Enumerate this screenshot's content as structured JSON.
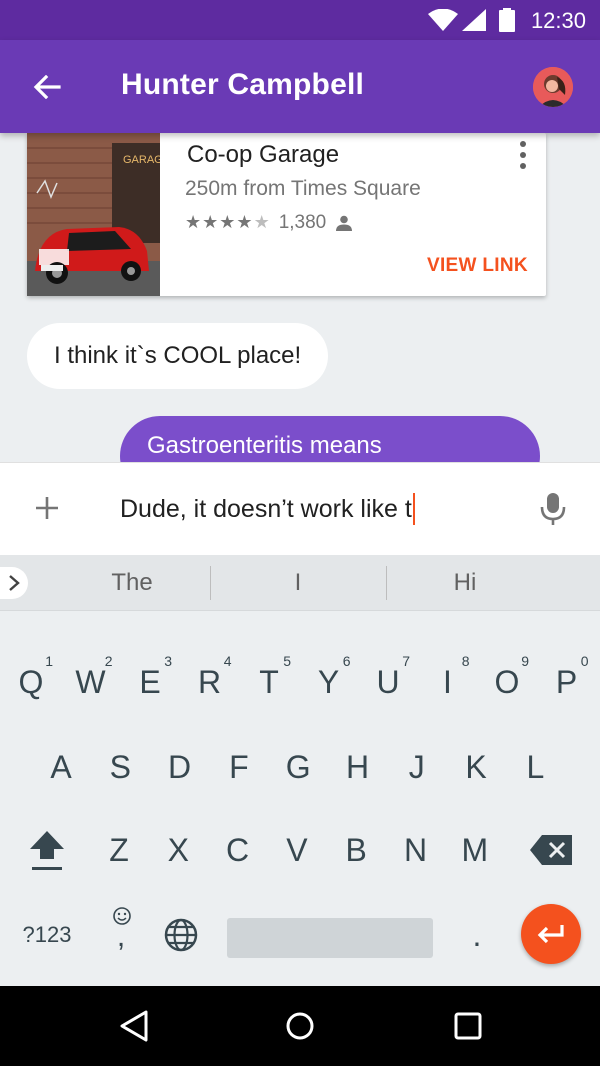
{
  "status_bar": {
    "time": "12:30"
  },
  "app_bar": {
    "contact_name": "Hunter Campbell"
  },
  "place_card": {
    "title": "Co-op Garage",
    "distance": "250m from Times Square",
    "rating": 4,
    "rating_max": 5,
    "rating_count": "1,380",
    "sign_text": "GARAGE",
    "action_label": "VIEW LINK"
  },
  "messages": {
    "incoming": "I think it`s COOL place!",
    "outgoing": "Gastroenteritis means"
  },
  "composer": {
    "input_value": "Dude, it doesn’t work like t"
  },
  "keyboard": {
    "suggestions": [
      "The",
      "I",
      "Hi"
    ],
    "row1": [
      {
        "label": "Q",
        "hint": "1"
      },
      {
        "label": "W",
        "hint": "2"
      },
      {
        "label": "E",
        "hint": "3"
      },
      {
        "label": "R",
        "hint": "4"
      },
      {
        "label": "T",
        "hint": "5"
      },
      {
        "label": "Y",
        "hint": "6"
      },
      {
        "label": "U",
        "hint": "7"
      },
      {
        "label": "I",
        "hint": "8"
      },
      {
        "label": "O",
        "hint": "9"
      },
      {
        "label": "P",
        "hint": "0"
      }
    ],
    "row2": [
      "A",
      "S",
      "D",
      "F",
      "G",
      "H",
      "J",
      "K",
      "L"
    ],
    "row3": [
      "Z",
      "X",
      "C",
      "V",
      "B",
      "N",
      "M"
    ],
    "symbols_label": "?123",
    "comma_label": ",",
    "period_label": "."
  },
  "colors": {
    "primary": "#6a3ab5",
    "status_bar": "#5e2ba0",
    "outgoing_bubble": "#7b4ecb",
    "accent": "#f4511e"
  },
  "icons": [
    "wifi-icon",
    "signal-icon",
    "battery-icon",
    "back-arrow-icon",
    "more-vert-icon",
    "star-icon",
    "person-icon",
    "plus-icon",
    "mic-icon",
    "chevron-right-icon",
    "shift-icon",
    "backspace-icon",
    "emoji-icon",
    "globe-icon",
    "enter-icon",
    "nav-back-icon",
    "nav-home-icon",
    "nav-recents-icon"
  ]
}
